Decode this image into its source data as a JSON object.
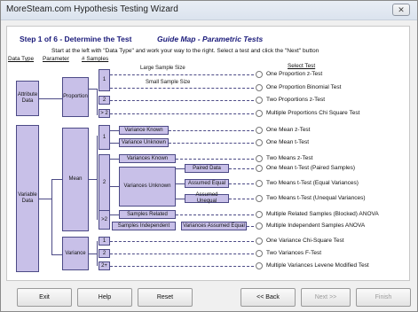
{
  "window": {
    "title": "MoreSteam.com Hypothesis Testing Wizard",
    "close_glyph": "✕"
  },
  "header": {
    "step": "Step 1 of 6 - Determine the Test",
    "guide": "Guide Map - Parametric Tests",
    "instruction": "Start at the left with \"Data Type\" and work your way to the right.  Select a test and click the \"Next\" button"
  },
  "columns": {
    "data_type": "Data Type",
    "parameter": "Parameter",
    "samples": "# Samples",
    "select_test": "Select Test"
  },
  "boxes": {
    "attribute_data": "Attribute Data",
    "variable_data": "Variable Data",
    "proportion": "Proportion",
    "mean": "Mean",
    "variance": "Variance",
    "p1": "1",
    "p2": "2",
    "p3": "> 2",
    "m1": "1",
    "m2": "2",
    "m3": ">2",
    "v1": "1",
    "v2": "2",
    "v3": "2+",
    "variance_known_1": "Variance Known",
    "variance_unknown_1": "Variance Unknown",
    "variance_known_2": "Variances Known",
    "variances_unknown_2": "Variances Unknown",
    "paired_data": "Paired Data",
    "assumed_equal": "Assumed Equal",
    "assumed_unequal": "Assumed Unequal",
    "samples_related": "Samples Related",
    "samples_independent": "Samples Independent",
    "variances_assumed_equal": "Variances Assumed Equal"
  },
  "labels": {
    "large_sample": "Large Sample Size",
    "small_sample": "Small Sample Size"
  },
  "tests": [
    "One Proportion z-Test",
    "One Proportion Binomial Test",
    "Two Proportions z-Test",
    "Multiple Proportions Chi Square Test",
    "One Mean z-Test",
    "One Mean t-Test",
    "Two Means z-Test",
    "One Mean t-Test (Paired Samples)",
    "Two Means t-Test (Equal Variances)",
    "Two Means t-Test (Unequal Variances)",
    "Multiple Related Samples (Blocked) ANOVA",
    "Multiple Independent Samples ANOVA",
    "One Variance Chi-Square Test",
    "Two Variances F-Test",
    "Multiple Variances Levene Modified Test"
  ],
  "buttons": {
    "exit": "Exit",
    "help": "Help",
    "reset": "Reset",
    "back": "<< Back",
    "next": "Next >>",
    "finish": "Finish"
  }
}
